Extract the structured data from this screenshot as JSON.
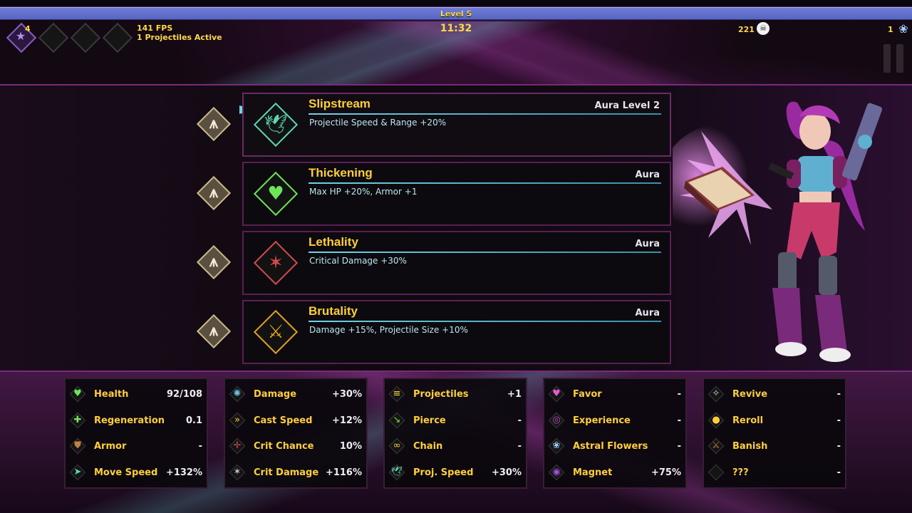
{
  "hud": {
    "level": "Level 5",
    "star_count": "4",
    "fps": "141 FPS",
    "projectiles_active": "1 Projectiles Active",
    "timer": "11:32",
    "kills": "221",
    "flowers": "1"
  },
  "choices": [
    {
      "name": "Slipstream",
      "tag": "Aura Level 2",
      "desc": "Projectile Speed & Range +20%",
      "icon": "dove-icon",
      "glyph": "🕊",
      "color": "#5fd6b5"
    },
    {
      "name": "Thickening",
      "tag": "Aura",
      "desc": "Max HP +20%, Armor +1",
      "icon": "heart-icon",
      "glyph": "♥",
      "color": "#6fe35a"
    },
    {
      "name": "Lethality",
      "tag": "Aura",
      "desc": "Critical Damage +30%",
      "icon": "crit-burst-icon",
      "glyph": "✶",
      "color": "#d34a4a"
    },
    {
      "name": "Brutality",
      "tag": "Aura",
      "desc": "Damage +15%, Projectile Size +10%",
      "icon": "slash-icon",
      "glyph": "⚔",
      "color": "#e0a020"
    }
  ],
  "stats": [
    [
      {
        "label": "Health",
        "value": "92/108",
        "icon": "heart-icon",
        "glyph": "♥",
        "color": "#6fe35a"
      },
      {
        "label": "Regeneration",
        "value": "0.1",
        "icon": "plus-icon",
        "glyph": "✚",
        "color": "#6fe35a"
      },
      {
        "label": "Armor",
        "value": "-",
        "icon": "shield-icon",
        "glyph": "⛊",
        "color": "#c08040"
      },
      {
        "label": "Move Speed",
        "value": "+132%",
        "icon": "boot-icon",
        "glyph": "➤",
        "color": "#5fd6b5"
      }
    ],
    [
      {
        "label": "Damage",
        "value": "+30%",
        "icon": "brain-icon",
        "glyph": "✺",
        "color": "#6fc3e6"
      },
      {
        "label": "Cast Speed",
        "value": "+12%",
        "icon": "fast-forward-icon",
        "glyph": "»",
        "color": "#ffcf3a"
      },
      {
        "label": "Crit Chance",
        "value": "10%",
        "icon": "crosshair-icon",
        "glyph": "✛",
        "color": "#d34a4a"
      },
      {
        "label": "Crit Damage",
        "value": "+116%",
        "icon": "crit-burst-icon",
        "glyph": "✶",
        "color": "#cccccc"
      }
    ],
    [
      {
        "label": "Projectiles",
        "value": "+1",
        "icon": "projectiles-icon",
        "glyph": "≡",
        "color": "#ffcf3a"
      },
      {
        "label": "Pierce",
        "value": "-",
        "icon": "pierce-icon",
        "glyph": "↘",
        "color": "#8ad640"
      },
      {
        "label": "Chain",
        "value": "-",
        "icon": "chain-icon",
        "glyph": "∞",
        "color": "#ffcf3a"
      },
      {
        "label": "Proj. Speed",
        "value": "+30%",
        "icon": "dove-icon",
        "glyph": "🕊",
        "color": "#5fd6b5"
      }
    ],
    [
      {
        "label": "Favor",
        "value": "-",
        "icon": "heart-hands-icon",
        "glyph": "♥",
        "color": "#e05ad0"
      },
      {
        "label": "Experience",
        "value": "-",
        "icon": "xp-orb-icon",
        "glyph": "◎",
        "color": "#c050d0"
      },
      {
        "label": "Astral Flowers",
        "value": "-",
        "icon": "flower-icon",
        "glyph": "❀",
        "color": "#9fd0ff"
      },
      {
        "label": "Magnet",
        "value": "+75%",
        "icon": "vortex-icon",
        "glyph": "◉",
        "color": "#a050e0"
      }
    ],
    [
      {
        "label": "Revive",
        "value": "-",
        "icon": "wings-icon",
        "glyph": "✧",
        "color": "#dddddd"
      },
      {
        "label": "Reroll",
        "value": "-",
        "icon": "dice-bag-icon",
        "glyph": "●",
        "color": "#ffcf3a"
      },
      {
        "label": "Banish",
        "value": "-",
        "icon": "banish-blade-icon",
        "glyph": "⚔",
        "color": "#c08040"
      },
      {
        "label": "???",
        "value": "-",
        "icon": "unknown-icon",
        "glyph": "",
        "color": "#555555"
      }
    ]
  ]
}
